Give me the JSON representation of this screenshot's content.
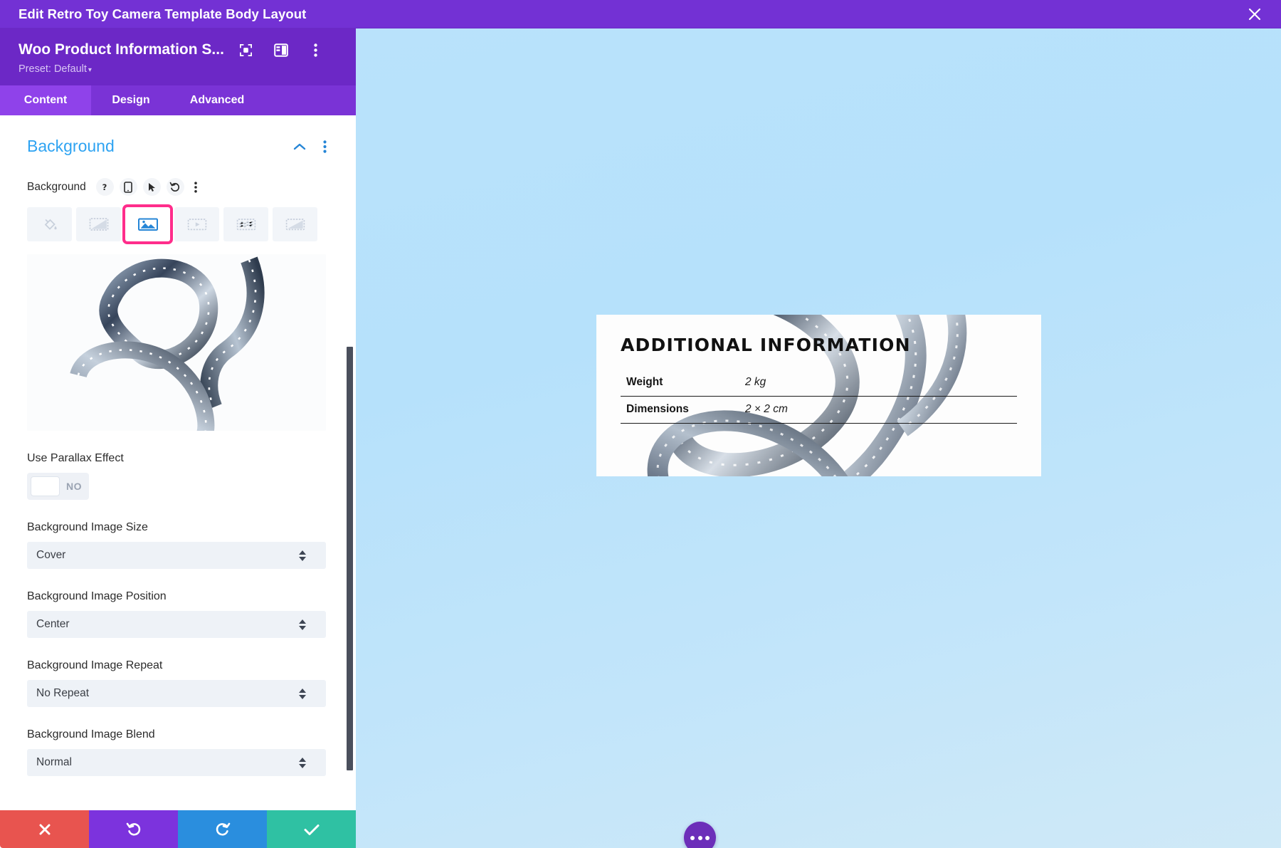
{
  "window": {
    "title": "Edit Retro Toy Camera Template Body Layout",
    "close_icon": "close-icon"
  },
  "panel": {
    "module_title": "Woo Product Information S...",
    "preset_label": "Preset: Default",
    "header_icons": [
      "focus-target-icon",
      "layout-panel-icon",
      "kebab-menu-icon"
    ],
    "tabs": [
      {
        "label": "Content",
        "active": true
      },
      {
        "label": "Design",
        "active": false
      },
      {
        "label": "Advanced",
        "active": false
      }
    ],
    "section": {
      "title": "Background",
      "collapse_icon": "chevron-up-icon",
      "options_icon": "kebab-menu-icon"
    },
    "background_field": {
      "label": "Background",
      "mini_buttons": [
        "help-icon",
        "responsive-mobile-icon",
        "hover-cursor-icon",
        "reset-undo-icon",
        "kebab-menu-icon"
      ],
      "types": [
        {
          "name": "background-color",
          "icon": "paint-bucket-icon",
          "selected": false
        },
        {
          "name": "background-gradient",
          "icon": "gradient-icon",
          "selected": false
        },
        {
          "name": "background-image",
          "icon": "image-icon",
          "selected": true
        },
        {
          "name": "background-video",
          "icon": "video-play-icon",
          "selected": false
        },
        {
          "name": "background-pattern",
          "icon": "pattern-grid-icon",
          "selected": false
        },
        {
          "name": "background-mask",
          "icon": "mask-icon",
          "selected": false
        }
      ],
      "thumbnail_alt": "film-strip-image"
    },
    "parallax": {
      "label": "Use Parallax Effect",
      "value": "NO"
    },
    "fields": [
      {
        "label": "Background Image Size",
        "value": "Cover"
      },
      {
        "label": "Background Image Position",
        "value": "Center"
      },
      {
        "label": "Background Image Repeat",
        "value": "No Repeat"
      },
      {
        "label": "Background Image Blend",
        "value": "Normal"
      }
    ],
    "actions": [
      {
        "name": "cancel-button",
        "icon": "close-x-icon",
        "color": "#e8544f"
      },
      {
        "name": "undo-button",
        "icon": "undo-arrow-icon",
        "color": "#7c33dd"
      },
      {
        "name": "redo-button",
        "icon": "redo-arrow-icon",
        "color": "#2a8ede"
      },
      {
        "name": "save-button",
        "icon": "check-icon",
        "color": "#2fc1a3"
      }
    ]
  },
  "preview": {
    "card": {
      "heading": "ADDITIONAL INFORMATION",
      "rows": [
        {
          "key": "Weight",
          "value": "2 kg"
        },
        {
          "key": "Dimensions",
          "value": "2 × 2 cm"
        }
      ]
    },
    "fab_icon": "more-options-icon",
    "background_color": "#bbe3fb"
  },
  "colors": {
    "titlebar": "#7331d4",
    "panel_header": "#6c28c6",
    "tab_active": "#8f42ea",
    "tab_bar": "#7a33d6",
    "accent_blue": "#2ea3f2",
    "selected_outline": "#ff2d8b"
  }
}
